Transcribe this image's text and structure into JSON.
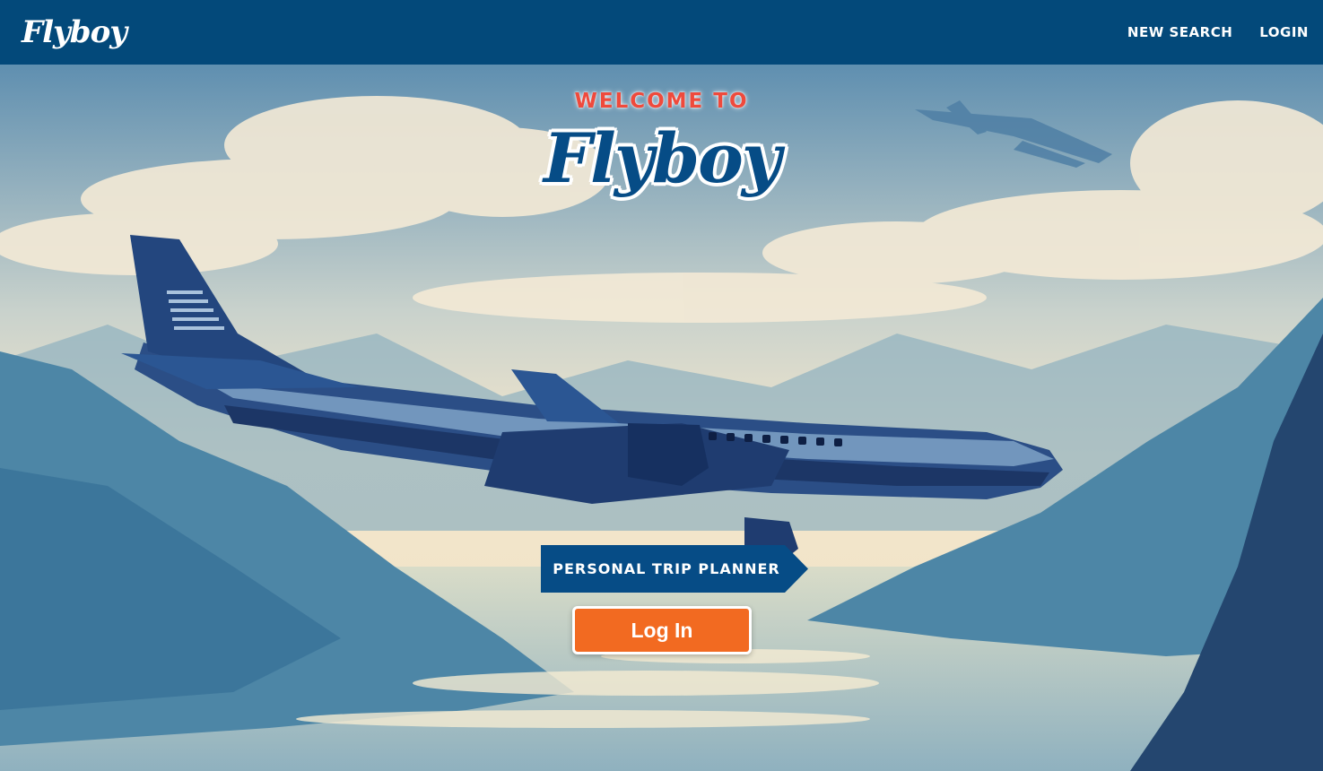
{
  "navbar": {
    "brand": "Flyboy",
    "links": [
      "NEW SEARCH",
      "LOGIN"
    ]
  },
  "hero": {
    "eyebrow": "WELCOME TO",
    "title": "Flyboy",
    "tagline": "PERSONAL TRIP PLANNER",
    "cta_label": "Log In"
  },
  "colors": {
    "navbar": "#03497a",
    "eyebrow": "#ef4a3c",
    "title": "#064c86",
    "ribbon": "#064c86",
    "cta": "#f26a21"
  }
}
